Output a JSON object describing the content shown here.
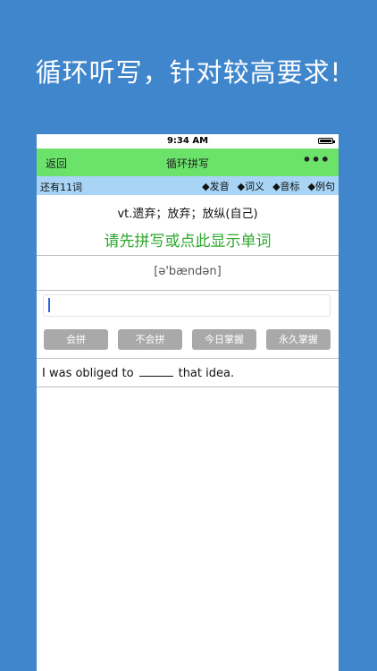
{
  "promo": {
    "title": "循环听写，针对较高要求!"
  },
  "status_bar": {
    "time": "9:34 AM",
    "battery_level": 1.0
  },
  "nav": {
    "back_label": "返回",
    "title": "循环拼写",
    "more_label": "•••"
  },
  "toolbar": {
    "remaining": "还有11词",
    "options": [
      {
        "label": "◆发音"
      },
      {
        "label": "◆词义"
      },
      {
        "label": "◆音标"
      },
      {
        "label": "◆例句"
      }
    ]
  },
  "word": {
    "meaning": "vt.遗弃；放弃；放纵(自己)",
    "reveal_prompt": "请先拼写或点此显示单词",
    "phonetic": "[ə'bændən]"
  },
  "spell_input": {
    "value": "",
    "placeholder": ""
  },
  "buttons": [
    {
      "label": "会拼"
    },
    {
      "label": "不会拼"
    },
    {
      "label": "今日掌握"
    },
    {
      "label": "永久掌握"
    }
  ],
  "example": {
    "before": "I was obliged to",
    "after": "that idea."
  },
  "colors": {
    "background": "#3f86cc",
    "nav_bar": "#6be36b",
    "toolbar": "#a8d4f5",
    "reveal_text": "#2ea82e",
    "button": "#a9a9a9"
  }
}
